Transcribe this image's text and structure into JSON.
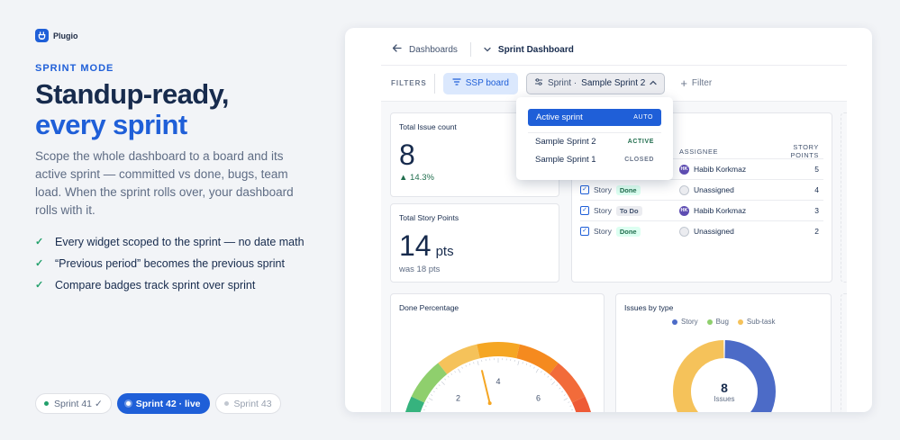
{
  "brand": {
    "name": "Plugio"
  },
  "hero": {
    "eyebrow": "SPRINT MODE",
    "headline_line1": "Standup-ready,",
    "headline_line2": "every sprint",
    "lede": "Scope the whole dashboard to a board and its active sprint — committed vs done, bugs, team load. When the sprint rolls over, your dashboard rolls with it.",
    "bullets": [
      "Every widget scoped to the sprint — no date math",
      "“Previous period” becomes the previous sprint",
      "Compare badges track sprint over sprint"
    ],
    "sprint_pills": [
      {
        "label": "Sprint 41 ✓",
        "state": "past"
      },
      {
        "label": "Sprint 42 · live",
        "state": "live"
      },
      {
        "label": "Sprint 43",
        "state": "future"
      }
    ]
  },
  "dashboard": {
    "breadcrumb": {
      "parent": "Dashboards",
      "title": "Sprint Dashboard"
    },
    "filters": {
      "label": "FILTERS",
      "board_chip": "SSP board",
      "sprint_chip_prefix": "Sprint ·",
      "sprint_chip_value": "Sample Sprint 2",
      "add_filter": "Filter"
    },
    "sprint_dropdown": {
      "active": {
        "label": "Active sprint",
        "tag": "AUTO"
      },
      "items": [
        {
          "label": "Sample Sprint 2",
          "tag": "ACTIVE"
        },
        {
          "label": "Sample Sprint 1",
          "tag": "CLOSED"
        }
      ]
    },
    "total_issue_count": {
      "title": "Total Issue count",
      "value": "8",
      "delta": "▲ 14.3%"
    },
    "total_story_points": {
      "title": "Total Story Points",
      "value": "14",
      "unit": "pts",
      "previous": "was 18 pts"
    },
    "issues_table": {
      "headers": {
        "assignee": "ASSIGNEE",
        "points": "STORY POINTS"
      },
      "rows": [
        {
          "type": "",
          "status": "",
          "assignee": "Habib Korkmaz",
          "initials": "HK",
          "points": "5"
        },
        {
          "type": "Story",
          "status": "Done",
          "assignee": "Unassigned",
          "initials": "",
          "points": "4"
        },
        {
          "type": "Story",
          "status": "To Do",
          "assignee": "Habib Korkmaz",
          "initials": "HK",
          "points": "3"
        },
        {
          "type": "Story",
          "status": "Done",
          "assignee": "Unassigned",
          "initials": "",
          "points": "2"
        }
      ]
    },
    "done_percentage": {
      "title": "Done Percentage",
      "ticks": [
        "2",
        "4",
        "6"
      ],
      "value_ratio": 0.4
    },
    "issues_by_type": {
      "title": "Issues by type",
      "legend": [
        {
          "name": "Story",
          "color": "#4c6bc7"
        },
        {
          "name": "Bug",
          "color": "#8fcf6d"
        },
        {
          "name": "Sub-task",
          "color": "#f5c25a"
        }
      ],
      "center_value": "8",
      "center_label": "Issues"
    }
  },
  "chart_data": [
    {
      "type": "pie",
      "title": "Issues by type",
      "categories": [
        "Story",
        "Bug",
        "Sub-task"
      ],
      "values": [
        4,
        1,
        3
      ],
      "total": 8,
      "legend": "top"
    },
    {
      "type": "gauge",
      "title": "Done Percentage",
      "ticks": [
        2,
        4,
        6
      ],
      "value": 3.4
    }
  ],
  "colors": {
    "accent": "#1f5fd8",
    "success": "#22a06b"
  }
}
